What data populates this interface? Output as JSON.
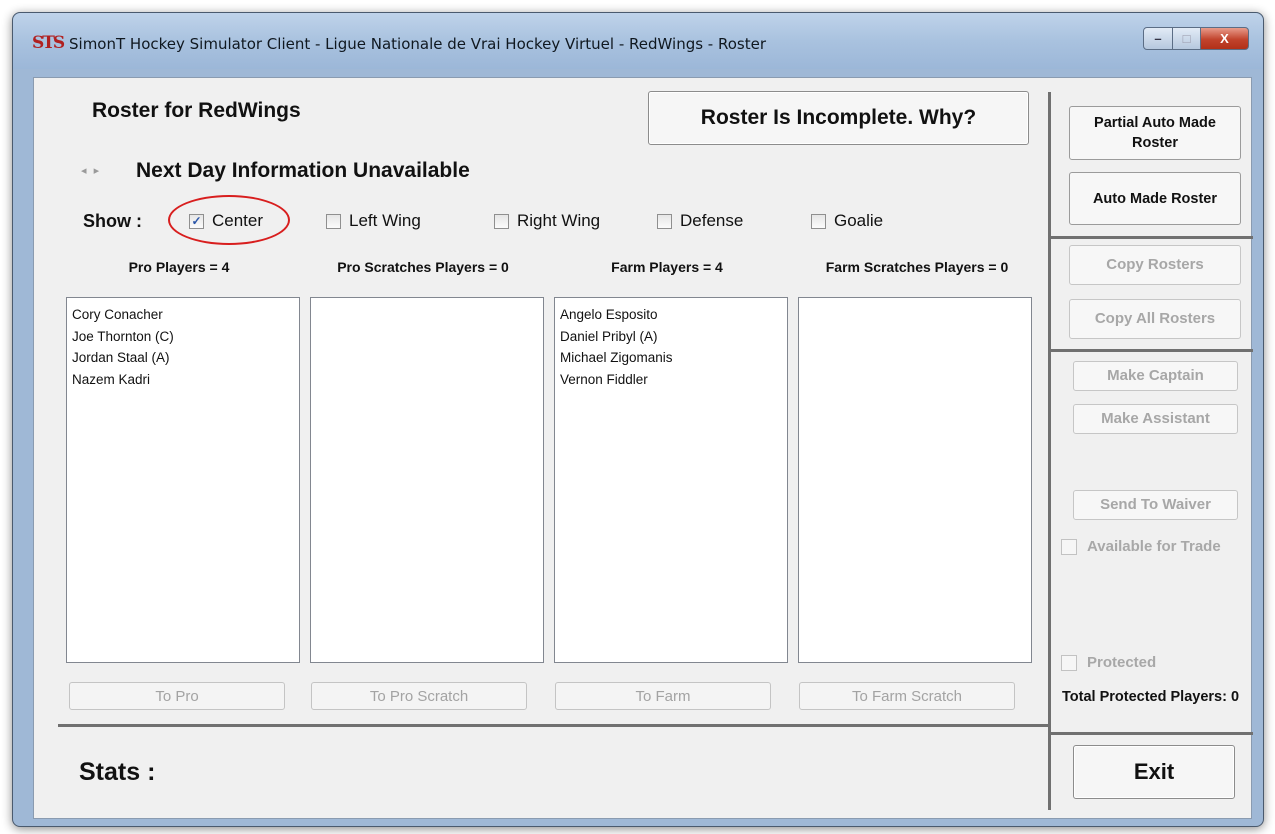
{
  "window": {
    "app_icon": "STS",
    "title": "SimonT Hockey Simulator Client - Ligue Nationale de Vrai Hockey Virtuel - RedWings - Roster",
    "controls": {
      "minimize": "–",
      "maximize": "□",
      "close": "X"
    }
  },
  "header": {
    "roster_title": "Roster for RedWings",
    "incomplete_button": "Roster Is Incomplete. Why?",
    "nav_arrows": "◂ ▸",
    "next_day": "Next Day Information Unavailable"
  },
  "filters": {
    "label": "Show :",
    "options": [
      {
        "label": "Center",
        "checked": true,
        "check_glyph": "✓"
      },
      {
        "label": "Left Wing",
        "checked": false
      },
      {
        "label": "Right Wing",
        "checked": false
      },
      {
        "label": "Defense",
        "checked": false
      },
      {
        "label": "Goalie",
        "checked": false
      }
    ],
    "highlight_color": "#d81e1e"
  },
  "columns": [
    {
      "header": "Pro Players = 4",
      "players": [
        "Cory Conacher",
        "Joe Thornton (C)",
        "Jordan Staal (A)",
        "Nazem Kadri"
      ],
      "button": "To Pro"
    },
    {
      "header": "Pro Scratches Players = 0",
      "players": [],
      "button": "To Pro Scratch"
    },
    {
      "header": "Farm Players = 4",
      "players": [
        "Angelo Esposito",
        "Daniel Pribyl (A)",
        "Michael Zigomanis",
        "Vernon Fiddler"
      ],
      "button": "To Farm"
    },
    {
      "header": "Farm Scratches Players = 0",
      "players": [],
      "button": "To Farm Scratch"
    }
  ],
  "stats_label": "Stats :",
  "side": {
    "partial_auto": "Partial Auto Made Roster",
    "auto": "Auto Made Roster",
    "copy_rosters": "Copy Rosters",
    "copy_all_rosters": "Copy All Rosters",
    "make_captain": "Make Captain",
    "make_assistant": "Make Assistant",
    "send_to_waiver": "Send To Waiver",
    "available_for_trade": "Available for Trade",
    "protected": "Protected",
    "total_protected": "Total Protected Players: 0",
    "exit": "Exit"
  }
}
